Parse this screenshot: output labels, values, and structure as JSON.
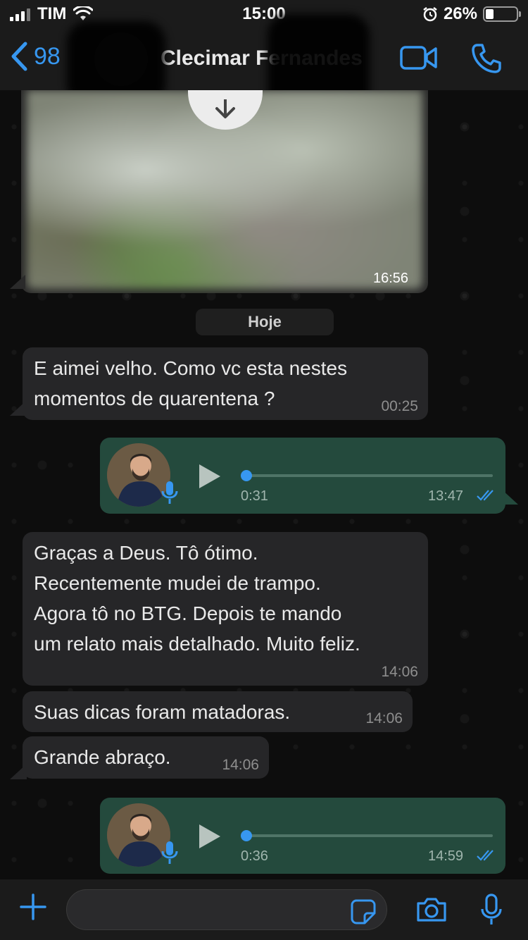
{
  "status_bar": {
    "carrier": "TIM",
    "time": "15:00",
    "battery_percent": "26%",
    "battery_level": 0.26
  },
  "header": {
    "back_count": "98",
    "contact_name": "Clecimar Fernandes",
    "icons": [
      "chevron-left-icon",
      "video-icon",
      "phone-icon"
    ]
  },
  "messages": {
    "image": {
      "time": "16:56"
    },
    "date_separator": "Hoje",
    "msg1": {
      "text": "E aimei velho. Como vc esta nestes\nmomentos de quarentena ?",
      "time": "00:25"
    },
    "audio1": {
      "duration": "0:31",
      "time": "13:47",
      "progress": 0
    },
    "msg2": {
      "text": "Graças a Deus. Tô ótimo.\nRecentemente mudei de trampo.\nAgora tô no BTG. Depois te mando\num relato mais detalhado. Muito feliz.",
      "time": "14:06"
    },
    "msg3": {
      "text": "Suas dicas foram matadoras.",
      "time": "14:06"
    },
    "msg4": {
      "text": "Grande abraço.",
      "time": "14:06"
    },
    "audio2": {
      "duration": "0:36",
      "time": "14:59",
      "progress": 0
    }
  },
  "composer": {
    "placeholder": "",
    "icons": [
      "plus-icon",
      "sticker-icon",
      "camera-icon",
      "microphone-icon"
    ]
  },
  "colors": {
    "accent": "#3797f0",
    "outgoing_bubble": "#244a3d",
    "incoming_bubble": "#262628",
    "bar": "#1b1b1b"
  }
}
